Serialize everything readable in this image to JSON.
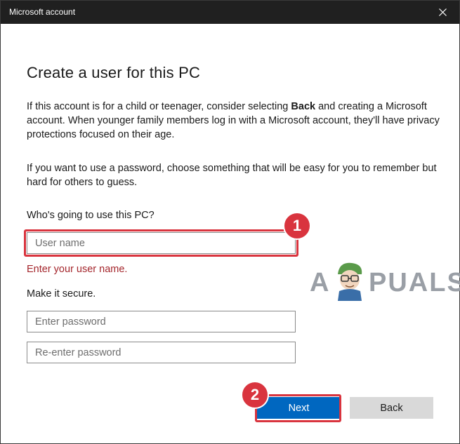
{
  "window": {
    "title": "Microsoft account"
  },
  "icons": {
    "close": "close-icon",
    "mascot": "appuals-mascot-icon"
  },
  "content": {
    "heading": "Create a user for this PC",
    "paragraph1_before_bold": "If this account is for a child or teenager, consider selecting ",
    "paragraph1_bold": "Back",
    "paragraph1_after_bold": " and creating a Microsoft account. When younger family members log in with a Microsoft account, they'll have privacy protections focused on their age.",
    "paragraph2": "If you want to use a password, choose something that will be easy for you to remember but hard for others to guess.",
    "who_label": "Who's going to use this PC?",
    "username_placeholder": "User name",
    "username_value": "",
    "error_text": "Enter your user name.",
    "secure_label": "Make it secure.",
    "password_placeholder": "Enter password",
    "repassword_placeholder": "Re-enter password"
  },
  "buttons": {
    "next": "Next",
    "back": "Back"
  },
  "annotations": {
    "step1": "1",
    "step2": "2",
    "highlight_color": "#d9343e"
  },
  "watermark": {
    "first_letter": "A",
    "rest": "PUALS"
  },
  "colors": {
    "accent": "#0067c0",
    "error": "#a4262c",
    "titlebar": "#202020"
  }
}
